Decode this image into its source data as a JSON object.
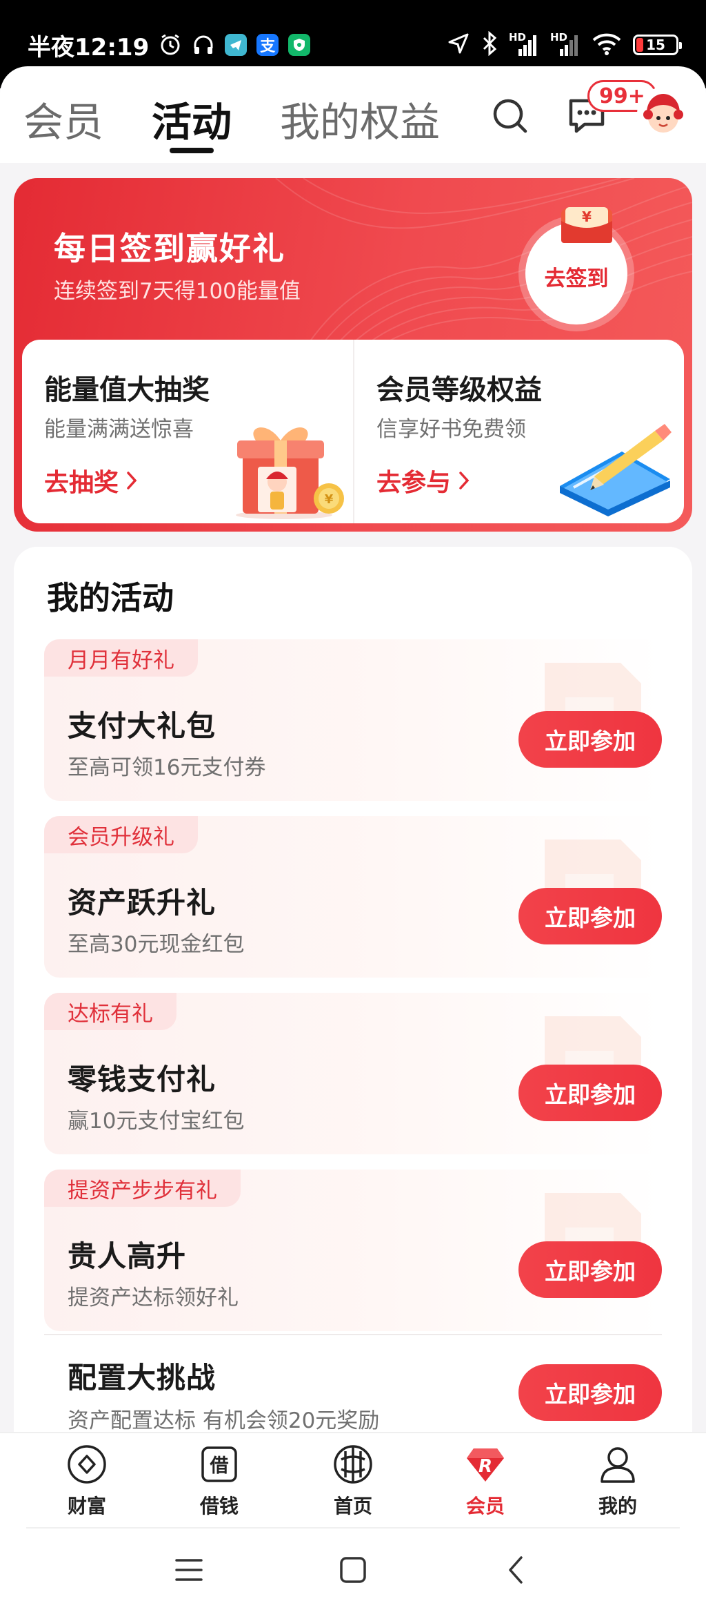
{
  "status_bar": {
    "time": "半夜12:19",
    "alipay_icon_text": "支",
    "battery_level": "15",
    "signal_label_1": "HD",
    "signal_label_2": "HD"
  },
  "header": {
    "tabs": [
      {
        "label": "会员"
      },
      {
        "label": "活动"
      },
      {
        "label": "我的权益"
      }
    ],
    "active_tab_index": 1,
    "message_badge": "99+"
  },
  "signin_banner": {
    "title": "每日签到赢好礼",
    "subtitle": "连续签到7天得100能量值",
    "envelope_symbol": "¥",
    "button_label": "去签到",
    "cards": [
      {
        "title": "能量值大抽奖",
        "subtitle": "能量满满送惊喜",
        "link": "去抽奖"
      },
      {
        "title": "会员等级权益",
        "subtitle": "信享好书免费领",
        "link": "去参与"
      }
    ]
  },
  "activities": {
    "heading": "我的活动",
    "items": [
      {
        "tag": "月月有好礼",
        "title": "支付大礼包",
        "desc": "至高可领16元支付券",
        "button": "立即参加"
      },
      {
        "tag": "会员升级礼",
        "title": "资产跃升礼",
        "desc": "至高30元现金红包",
        "button": "立即参加"
      },
      {
        "tag": "达标有礼",
        "title": "零钱支付礼",
        "desc": "赢10元支付宝红包",
        "button": "立即参加"
      },
      {
        "tag": "提资产步步有礼",
        "title": "贵人高升",
        "desc": "提资产达标领好礼",
        "button": "立即参加"
      },
      {
        "tag": "",
        "title": "配置大挑战",
        "desc": "资产配置达标 有机会领20元奖励",
        "button": "立即参加"
      }
    ]
  },
  "bottom_nav": {
    "items": [
      {
        "label": "财富",
        "icon": "wealth-icon"
      },
      {
        "label": "借钱",
        "icon": "borrow-icon"
      },
      {
        "label": "首页",
        "icon": "home-icon"
      },
      {
        "label": "会员",
        "icon": "member-icon"
      },
      {
        "label": "我的",
        "icon": "profile-icon"
      }
    ],
    "active_index": 3,
    "borrow_icon_char": "借",
    "member_icon_char": "R"
  },
  "colors": {
    "accent": "#e42b34",
    "tag_bg": "#fde3e3",
    "button": "#ef3540"
  }
}
